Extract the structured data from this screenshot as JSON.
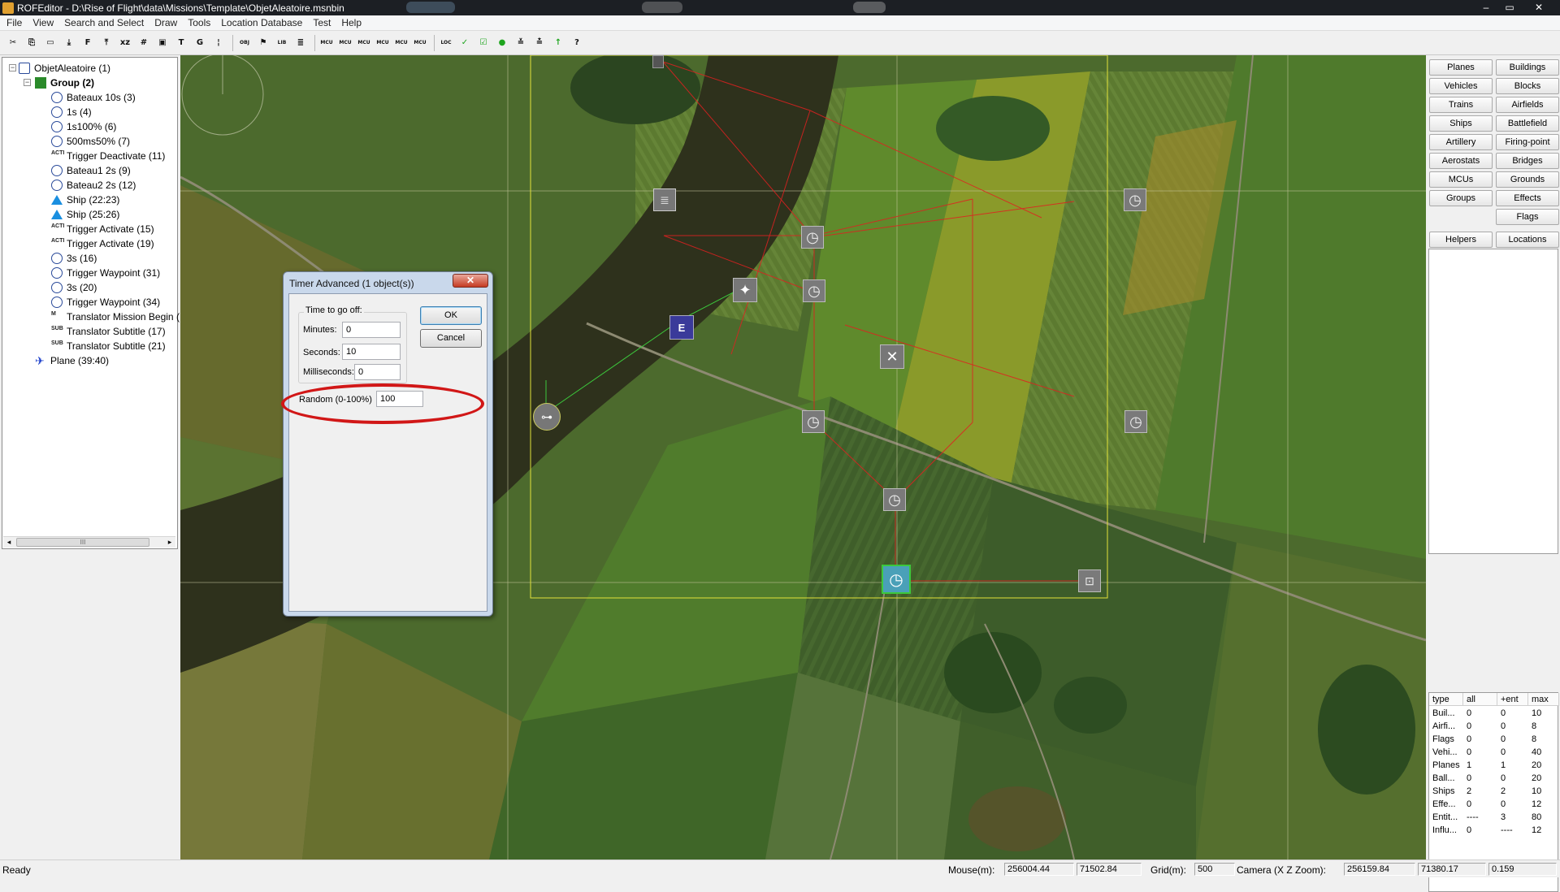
{
  "window": {
    "title": "ROFEditor - D:\\Rise of Flight\\data\\Missions\\Template\\ObjetAleatoire.msnbin",
    "controls": [
      "–",
      "▭",
      "✕"
    ]
  },
  "menu": [
    "File",
    "View",
    "Search and Select",
    "Draw",
    "Tools",
    "Location Database",
    "Test",
    "Help"
  ],
  "toolbar": [
    {
      "icon": "cut-icon",
      "glyph": "✂"
    },
    {
      "icon": "copy-icon",
      "glyph": "⎘"
    },
    {
      "icon": "ruler-icon",
      "glyph": "▭"
    },
    {
      "icon": "import-icon",
      "glyph": "⤓"
    },
    {
      "icon": "font-icon",
      "glyph": "F"
    },
    {
      "icon": "export-icon",
      "glyph": "⤒"
    },
    {
      "icon": "xz-icon",
      "glyph": "xz"
    },
    {
      "icon": "grid-icon",
      "glyph": "#"
    },
    {
      "icon": "frame-icon",
      "glyph": "▣"
    },
    {
      "icon": "text-tool-icon",
      "glyph": "T"
    },
    {
      "icon": "graph-icon",
      "glyph": "G"
    },
    {
      "icon": "pin-icon",
      "glyph": "¦"
    },
    {
      "icon": "obj-filter-icon",
      "glyph": "OBJ"
    },
    {
      "icon": "flag-tool-icon",
      "glyph": "⚑"
    },
    {
      "icon": "lib-icon",
      "glyph": "LIB"
    },
    {
      "icon": "align-icon",
      "glyph": "≣"
    },
    {
      "icon": "mcu-obj-icon",
      "glyph": "MCU"
    },
    {
      "icon": "mcu-tar-icon",
      "glyph": "MCU"
    },
    {
      "icon": "mcu-mes-icon",
      "glyph": "MCU"
    },
    {
      "icon": "mcu-sel-icon",
      "glyph": "MCU"
    },
    {
      "icon": "mcu-unsel-icon",
      "glyph": "MCU"
    },
    {
      "icon": "mcu-arw-icon",
      "glyph": "MCU"
    },
    {
      "icon": "loc-icon",
      "glyph": "LOC"
    },
    {
      "icon": "check-icon",
      "glyph": "✓"
    },
    {
      "icon": "check-box-icon",
      "glyph": "☑"
    },
    {
      "icon": "green-dot-icon",
      "glyph": "●"
    },
    {
      "icon": "layers-icon",
      "glyph": "≚"
    },
    {
      "icon": "stack-icon",
      "glyph": "≛"
    },
    {
      "icon": "up-arrow-icon",
      "glyph": "↑"
    },
    {
      "icon": "help-icon",
      "glyph": "?"
    }
  ],
  "tree": [
    {
      "label": "ObjetAleatoire (1)",
      "icon": "mission-icon",
      "bold": false
    },
    {
      "label": "Group (2)",
      "icon": "group-icon",
      "bold": true
    },
    {
      "label": "Bateaux 10s (3)",
      "icon": "timer-icon"
    },
    {
      "label": "1s (4)",
      "icon": "timer-icon"
    },
    {
      "label": "1s100% (6)",
      "icon": "timer-icon"
    },
    {
      "label": "500ms50% (7)",
      "icon": "timer-icon"
    },
    {
      "label": "Trigger Deactivate (11)",
      "icon": "deactivate-icon"
    },
    {
      "label": "Bateau1 2s (9)",
      "icon": "timer-icon"
    },
    {
      "label": "Bateau2 2s (12)",
      "icon": "timer-icon"
    },
    {
      "label": "Ship (22:23)",
      "icon": "ship-icon"
    },
    {
      "label": "Ship (25:26)",
      "icon": "ship-icon"
    },
    {
      "label": "Trigger Activate (15)",
      "icon": "activate-icon"
    },
    {
      "label": "Trigger Activate (19)",
      "icon": "activate-icon"
    },
    {
      "label": "3s (16)",
      "icon": "timer-icon"
    },
    {
      "label": "Trigger Waypoint (31)",
      "icon": "waypoint-icon"
    },
    {
      "label": "3s (20)",
      "icon": "timer-icon"
    },
    {
      "label": "Trigger Waypoint (34)",
      "icon": "waypoint-icon"
    },
    {
      "label": "Translator Mission Begin (",
      "icon": "mission-begin-icon"
    },
    {
      "label": "Translator Subtitle (17)",
      "icon": "subtitle-icon"
    },
    {
      "label": "Translator Subtitle (21)",
      "icon": "subtitle-icon"
    },
    {
      "label": "Plane (39:40)",
      "icon": "plane-icon"
    }
  ],
  "tree_scroll_grip": "III",
  "right_buttons": [
    [
      "Planes",
      "Buildings"
    ],
    [
      "Vehicles",
      "Blocks"
    ],
    [
      "Trains",
      "Airfields"
    ],
    [
      "Ships",
      "Battlefield"
    ],
    [
      "Artillery",
      "Firing-point"
    ],
    [
      "Aerostats",
      "Bridges"
    ],
    [
      "MCUs",
      "Grounds"
    ],
    [
      "Groups",
      "Effects"
    ],
    [
      "",
      "Flags"
    ],
    [
      "Helpers",
      "Locations"
    ]
  ],
  "stats": {
    "headers": [
      "type",
      "all",
      "+ent",
      "max"
    ],
    "rows": [
      [
        "Buil...",
        "0",
        "0",
        "10"
      ],
      [
        "Airfi...",
        "0",
        "0",
        "8"
      ],
      [
        "Flags",
        "0",
        "0",
        "8"
      ],
      [
        "Vehi...",
        "0",
        "0",
        "40"
      ],
      [
        "Planes",
        "1",
        "1",
        "20"
      ],
      [
        "Ball...",
        "0",
        "0",
        "20"
      ],
      [
        "Ships",
        "2",
        "2",
        "10"
      ],
      [
        "Effe...",
        "0",
        "0",
        "12"
      ],
      [
        "Entit...",
        "----",
        "3",
        "80"
      ],
      [
        "Influ...",
        "0",
        "----",
        "12"
      ]
    ]
  },
  "dialog": {
    "title": "Timer Advanced (1 object(s))",
    "close": "✕",
    "group_label": "Time to go off:",
    "minutes_label": "Minutes:",
    "minutes_value": "0",
    "seconds_label": "Seconds:",
    "seconds_value": "10",
    "ms_label": "Milliseconds:",
    "ms_value": "0",
    "random_label": "Random (0-100%)",
    "random_value": "100",
    "ok": "OK",
    "cancel": "Cancel"
  },
  "status": {
    "ready": "Ready",
    "mouse_label": "Mouse(m):",
    "mouse_x": "256004.44",
    "mouse_z": "71502.84",
    "grid_label": "Grid(m):",
    "grid_value": "500",
    "camera_label": "Camera (X  Z  Zoom):",
    "camera_x": "256159.84",
    "camera_z": "71380.17",
    "zoom": "0.159"
  },
  "colors": {
    "selection": "#e2e23a",
    "links": "#e02020",
    "waypoint_link": "#3cc83c",
    "ellipse": "#d11717"
  }
}
